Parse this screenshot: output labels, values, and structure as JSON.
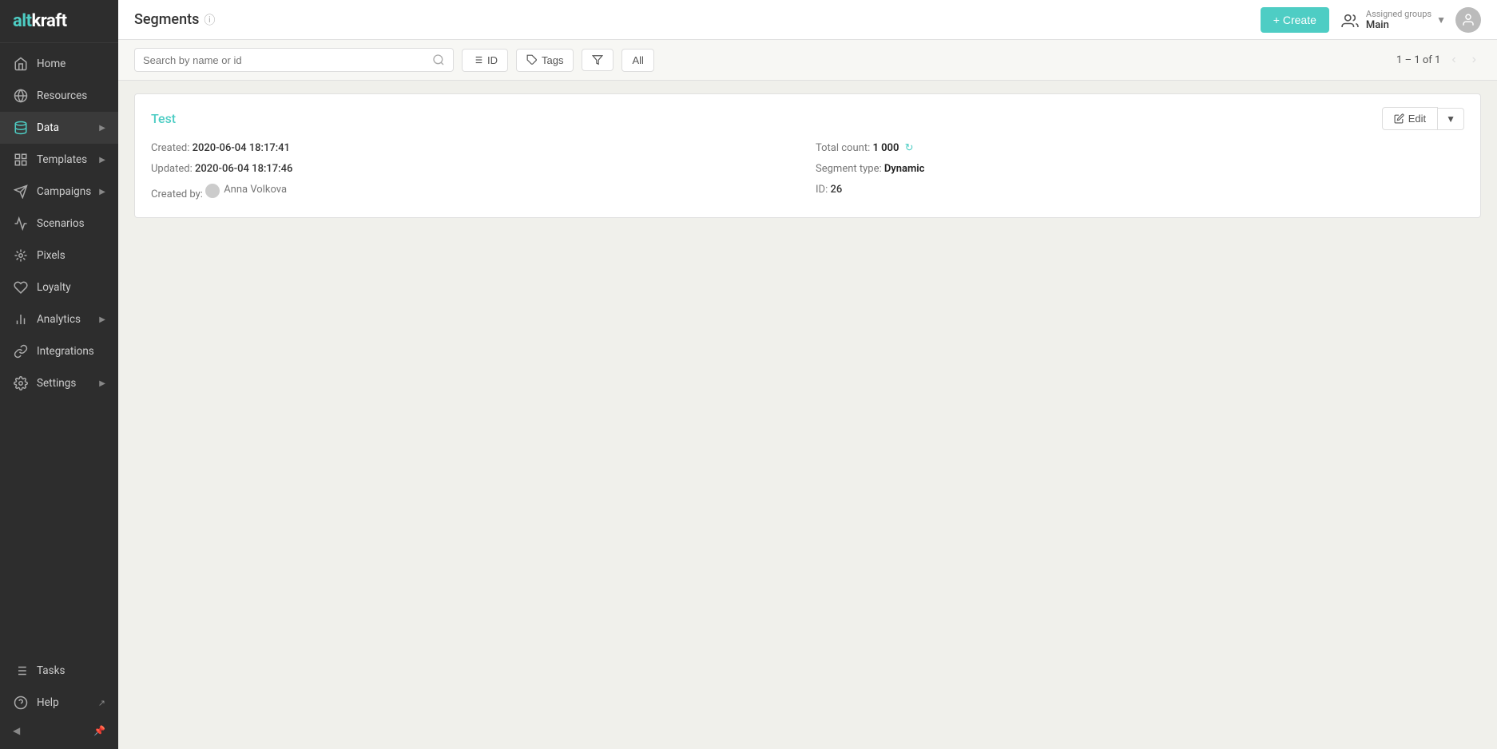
{
  "sidebar": {
    "logo": "altkraft",
    "items": [
      {
        "id": "home",
        "label": "Home",
        "icon": "home",
        "active": false,
        "hasArrow": false
      },
      {
        "id": "resources",
        "label": "Resources",
        "icon": "resources",
        "active": false,
        "hasArrow": false
      },
      {
        "id": "data",
        "label": "Data",
        "icon": "data",
        "active": true,
        "hasArrow": true
      },
      {
        "id": "templates",
        "label": "Templates",
        "icon": "templates",
        "active": false,
        "hasArrow": true
      },
      {
        "id": "campaigns",
        "label": "Campaigns",
        "icon": "campaigns",
        "active": false,
        "hasArrow": true
      },
      {
        "id": "scenarios",
        "label": "Scenarios",
        "icon": "scenarios",
        "active": false,
        "hasArrow": false
      },
      {
        "id": "pixels",
        "label": "Pixels",
        "icon": "pixels",
        "active": false,
        "hasArrow": false
      },
      {
        "id": "loyalty",
        "label": "Loyalty",
        "icon": "loyalty",
        "active": false,
        "hasArrow": false
      },
      {
        "id": "analytics",
        "label": "Analytics",
        "icon": "analytics",
        "active": false,
        "hasArrow": true
      },
      {
        "id": "integrations",
        "label": "Integrations",
        "icon": "integrations",
        "active": false,
        "hasArrow": false
      },
      {
        "id": "settings",
        "label": "Settings",
        "icon": "settings",
        "active": false,
        "hasArrow": true
      }
    ],
    "bottom_items": [
      {
        "id": "tasks",
        "label": "Tasks",
        "icon": "tasks"
      },
      {
        "id": "help",
        "label": "Help",
        "icon": "help"
      }
    ]
  },
  "header": {
    "title": "Segments",
    "create_label": "+ Create",
    "assigned_groups_label": "Assigned groups",
    "group_name": "Main"
  },
  "toolbar": {
    "search_placeholder": "Search by name or id",
    "sort_label": "ID",
    "tags_label": "Tags",
    "filter_label": "All",
    "pagination": "1 – 1 of 1"
  },
  "segments": [
    {
      "name": "Test",
      "created_label": "Created:",
      "created_value": "2020-06-04 18:17:41",
      "updated_label": "Updated:",
      "updated_value": "2020-06-04 18:17:46",
      "created_by_label": "Created by:",
      "creator_name": "Anna Volkova",
      "id_label": "ID:",
      "id_value": "26",
      "total_count_label": "Total count:",
      "total_count_value": "1 000",
      "segment_type_label": "Segment type:",
      "segment_type_value": "Dynamic",
      "edit_label": "Edit"
    }
  ]
}
